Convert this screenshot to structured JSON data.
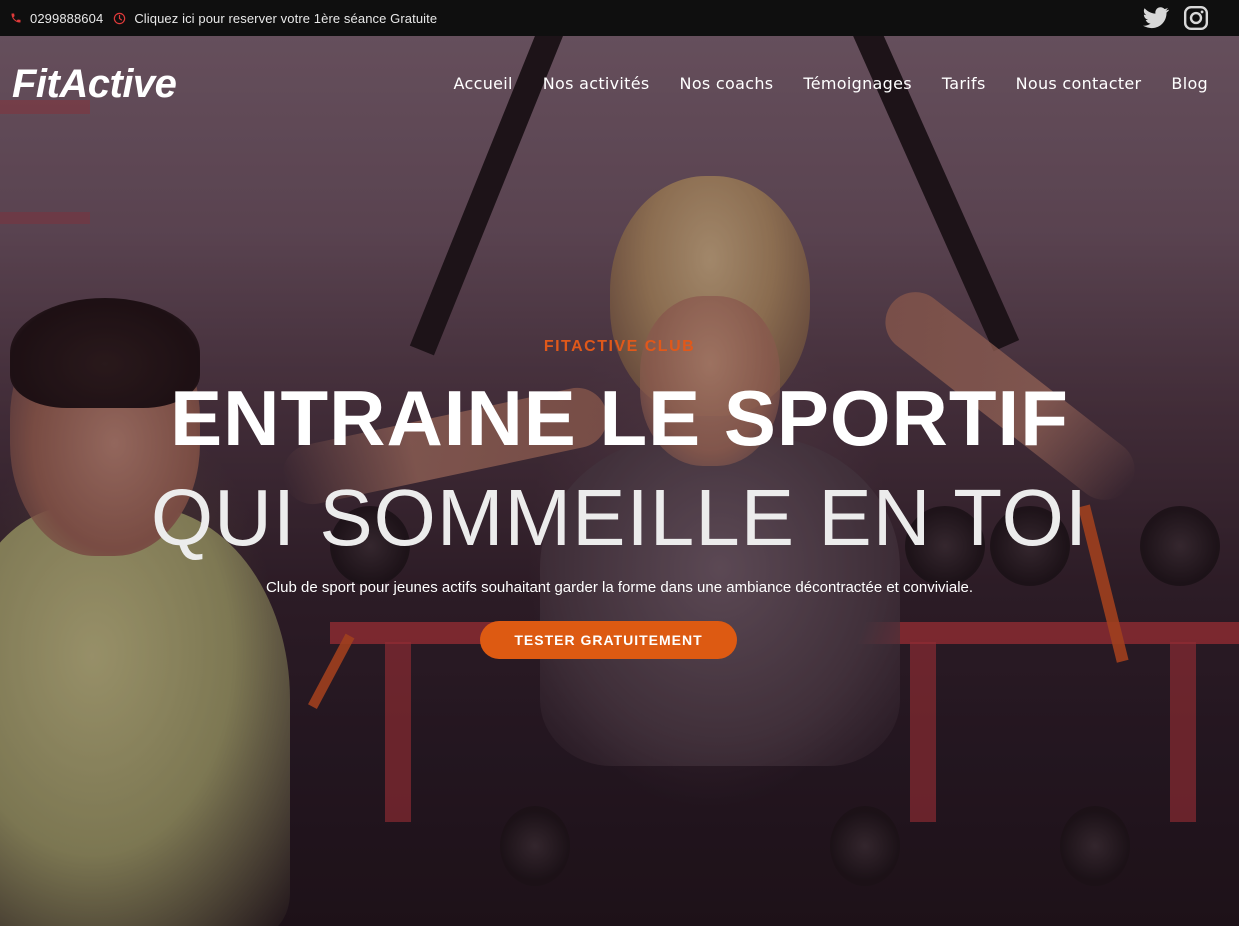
{
  "topbar": {
    "phone": "0299888604",
    "promo": "Cliquez ici pour reserver votre 1ère séance Gratuite",
    "icons": [
      "phone-icon",
      "clock-icon",
      "twitter-icon",
      "instagram-icon"
    ]
  },
  "header": {
    "logo": "FitActive",
    "nav": [
      "Accueil",
      "Nos activités",
      "Nos coachs",
      "Témoignages",
      "Tarifs",
      "Nous contacter",
      "Blog"
    ]
  },
  "hero": {
    "kicker": "FITACTIVE CLUB",
    "headline_1": "ENTRAINE LE SPORTIF",
    "headline_2": "QUI SOMMEILLE EN TOI",
    "subtitle": "Club de sport pour jeunes actifs souhaitant garder la forme dans une ambiance décontractée et conviviale.",
    "cta": "TESTER GRATUITEMENT"
  },
  "colors": {
    "accent": "#dd5a12",
    "icon_red": "#e03a3a",
    "topbar_bg": "#0f0f0f"
  }
}
